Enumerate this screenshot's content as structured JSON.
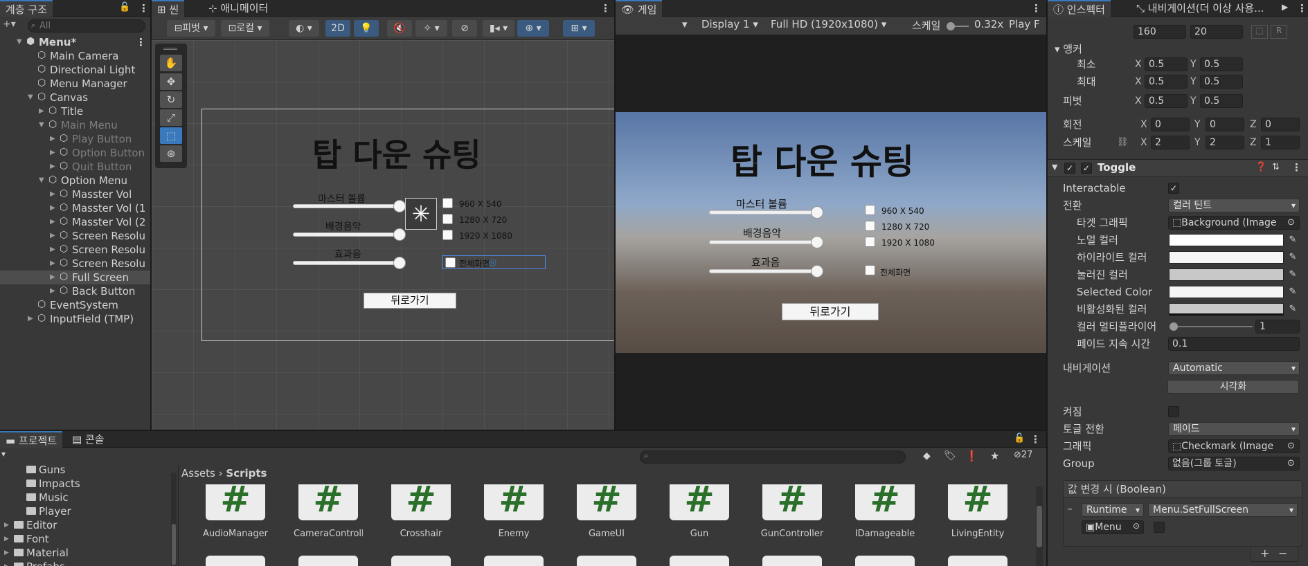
{
  "hierarchy": {
    "tab_label": "계층 구조",
    "search_placeholder": "All",
    "items": [
      {
        "label": "Menu*",
        "depth": 0
      },
      {
        "label": "Main Camera",
        "depth": 1
      },
      {
        "label": "Directional Light",
        "depth": 1
      },
      {
        "label": "Menu Manager",
        "depth": 1
      },
      {
        "label": "Canvas",
        "depth": 1
      },
      {
        "label": "Title",
        "depth": 2
      },
      {
        "label": "Main Menu",
        "depth": 2
      },
      {
        "label": "Play Button",
        "depth": 3
      },
      {
        "label": "Option Button",
        "depth": 3
      },
      {
        "label": "Quit Button",
        "depth": 3
      },
      {
        "label": "Option Menu",
        "depth": 2
      },
      {
        "label": "Masster Vol",
        "depth": 3
      },
      {
        "label": "Masster Vol (1",
        "depth": 3
      },
      {
        "label": "Masster Vol (2",
        "depth": 3
      },
      {
        "label": "Screen Resolu",
        "depth": 3
      },
      {
        "label": "Screen Resolu",
        "depth": 3
      },
      {
        "label": "Screen Resolu",
        "depth": 3
      },
      {
        "label": "Full Screen",
        "depth": 3
      },
      {
        "label": "Back Button",
        "depth": 3
      },
      {
        "label": "EventSystem",
        "depth": 1
      },
      {
        "label": "InputField (TMP)",
        "depth": 1
      }
    ]
  },
  "scene": {
    "tab_scene": "씬",
    "tab_animator": "애니메이터",
    "pivot_label": "피벗",
    "local_label": "로컬",
    "mode_2d": "2D"
  },
  "game": {
    "tab_label": "게임",
    "display": "Display 1",
    "resolution": "Full HD (1920x1080)",
    "scale_label": "스케일",
    "scale_value": "0.32x",
    "play_label": "Play F"
  },
  "menu_ui": {
    "title": "탑 다운 슈팅",
    "master_volume": "마스터 볼륨",
    "bgm": "배경음악",
    "sfx": "효과음",
    "res1": "960 X 540",
    "res2": "1280 X 720",
    "res3": "1920 X 1080",
    "fullscreen": "전체화면",
    "back": "뒤로가기"
  },
  "inspector": {
    "tab_inspector": "인스펙터",
    "tab_navigation": "내비게이션(더 이상 사용...",
    "width_value": "160",
    "height_value": "20",
    "anchor_label": "앵커",
    "min_label": "최소",
    "max_label": "최대",
    "pivot_label": "피벗",
    "anchor_min": {
      "x": "0.5",
      "y": "0.5"
    },
    "anchor_max": {
      "x": "0.5",
      "y": "0.5"
    },
    "pivot": {
      "x": "0.5",
      "y": "0.5"
    },
    "rotation_label": "회전",
    "rotation": {
      "x": "0",
      "y": "0",
      "z": "0"
    },
    "scale_label": "스케일",
    "scale": {
      "x": "2",
      "y": "2",
      "z": "1"
    },
    "component_title": "Toggle",
    "interactable_label": "Interactable",
    "transition_label": "전환",
    "transition_value": "컬러 틴트",
    "target_graphic_label": "타겟 그래픽",
    "target_graphic_value": "Background (Image",
    "normal_color_label": "노멀 컬러",
    "highlight_color_label": "하이라이트 컬러",
    "pressed_color_label": "눌러진 컬러",
    "selected_color_label": "Selected Color",
    "disabled_color_label": "비활성화된 컬러",
    "multiplier_label": "컬러 멀티플라이어",
    "multiplier_value": "1",
    "fade_label": "페이드 지속 시간",
    "fade_value": "0.1",
    "navigation_label": "내비게이션",
    "navigation_value": "Automatic",
    "visualize_button": "시각화",
    "is_on_label": "켜짐",
    "toggle_transition_label": "토글 전환",
    "toggle_transition_value": "페이드",
    "graphic_label": "그래픽",
    "graphic_value": "Checkmark (Image",
    "group_label": "Group",
    "group_value": "없음(그룹 토글)",
    "event_label": "값 변경 시 (Boolean)",
    "runtime_value": "Runtime",
    "function_value": "Menu.SetFullScreen",
    "object_value": "Menu",
    "plus": "+",
    "minus": "−"
  },
  "project": {
    "tab_project": "프로젝트",
    "tab_console": "콘솔",
    "hidden_count": "27",
    "breadcrumb_root": "Assets",
    "breadcrumb_leaf": "Scripts",
    "folders": [
      "Guns",
      "Impacts",
      "Music",
      "Player",
      "Editor",
      "Font",
      "Material",
      "Prefabs"
    ],
    "scripts": [
      "AudioManager",
      "CameraControll...",
      "Crosshair",
      "Enemy",
      "GameUI",
      "Gun",
      "GunController",
      "IDamageable",
      "LivingEntity"
    ]
  },
  "colors": {
    "accent": "#3a79bb",
    "panel": "#383838",
    "script_icon": "#2a6f2a"
  }
}
